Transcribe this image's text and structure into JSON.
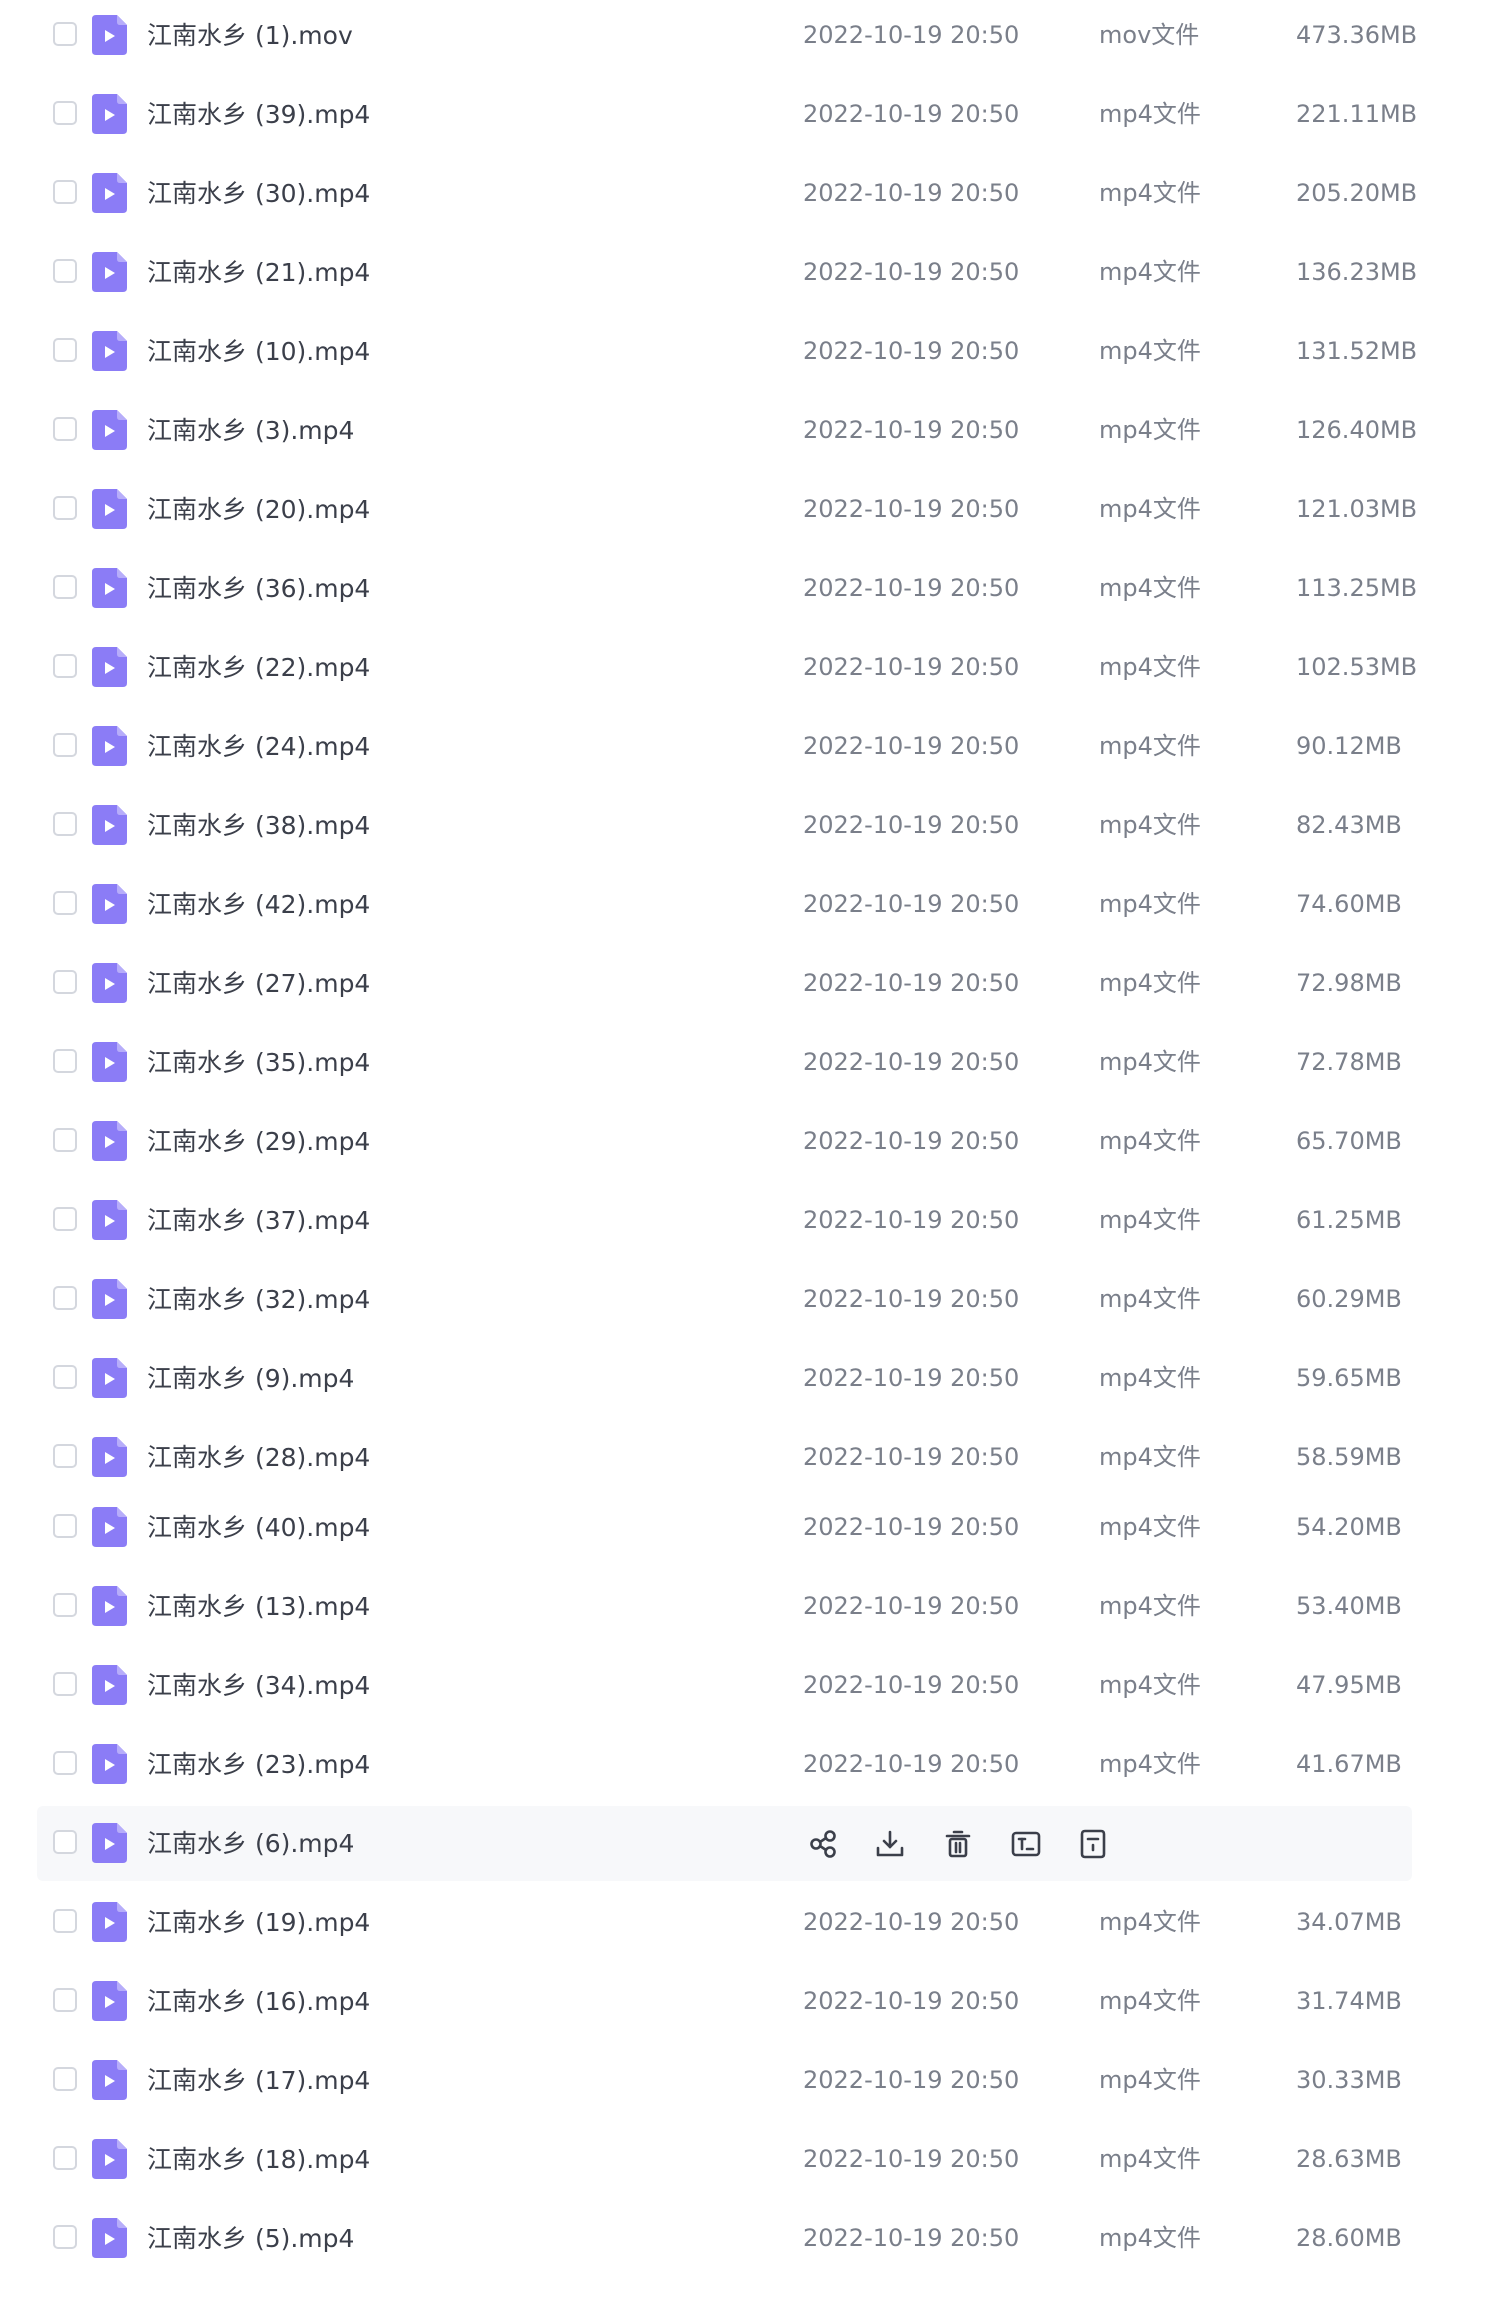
{
  "colors": {
    "icon_purple": "#8b7cf6",
    "text_primary": "#3b3f4a",
    "text_secondary": "#7a7f8a",
    "hover_row": "#f7f8fa"
  },
  "files": [
    {
      "name": "江南水乡 (1).mov",
      "date": "2022-10-19 20:50",
      "type": "mov文件",
      "size": "473.36MB"
    },
    {
      "name": "江南水乡 (39).mp4",
      "date": "2022-10-19 20:50",
      "type": "mp4文件",
      "size": "221.11MB"
    },
    {
      "name": "江南水乡 (30).mp4",
      "date": "2022-10-19 20:50",
      "type": "mp4文件",
      "size": "205.20MB"
    },
    {
      "name": "江南水乡 (21).mp4",
      "date": "2022-10-19 20:50",
      "type": "mp4文件",
      "size": "136.23MB"
    },
    {
      "name": "江南水乡 (10).mp4",
      "date": "2022-10-19 20:50",
      "type": "mp4文件",
      "size": "131.52MB"
    },
    {
      "name": "江南水乡 (3).mp4",
      "date": "2022-10-19 20:50",
      "type": "mp4文件",
      "size": "126.40MB"
    },
    {
      "name": "江南水乡 (20).mp4",
      "date": "2022-10-19 20:50",
      "type": "mp4文件",
      "size": "121.03MB"
    },
    {
      "name": "江南水乡 (36).mp4",
      "date": "2022-10-19 20:50",
      "type": "mp4文件",
      "size": "113.25MB"
    },
    {
      "name": "江南水乡 (22).mp4",
      "date": "2022-10-19 20:50",
      "type": "mp4文件",
      "size": "102.53MB"
    },
    {
      "name": "江南水乡 (24).mp4",
      "date": "2022-10-19 20:50",
      "type": "mp4文件",
      "size": "90.12MB"
    },
    {
      "name": "江南水乡 (38).mp4",
      "date": "2022-10-19 20:50",
      "type": "mp4文件",
      "size": "82.43MB"
    },
    {
      "name": "江南水乡 (42).mp4",
      "date": "2022-10-19 20:50",
      "type": "mp4文件",
      "size": "74.60MB"
    },
    {
      "name": "江南水乡 (27).mp4",
      "date": "2022-10-19 20:50",
      "type": "mp4文件",
      "size": "72.98MB"
    },
    {
      "name": "江南水乡 (35).mp4",
      "date": "2022-10-19 20:50",
      "type": "mp4文件",
      "size": "72.78MB"
    },
    {
      "name": "江南水乡 (29).mp4",
      "date": "2022-10-19 20:50",
      "type": "mp4文件",
      "size": "65.70MB"
    },
    {
      "name": "江南水乡 (37).mp4",
      "date": "2022-10-19 20:50",
      "type": "mp4文件",
      "size": "61.25MB"
    },
    {
      "name": "江南水乡 (32).mp4",
      "date": "2022-10-19 20:50",
      "type": "mp4文件",
      "size": "60.29MB"
    },
    {
      "name": "江南水乡 (9).mp4",
      "date": "2022-10-19 20:50",
      "type": "mp4文件",
      "size": "59.65MB"
    },
    {
      "name": "江南水乡 (28).mp4",
      "date": "2022-10-19 20:50",
      "type": "mp4文件",
      "size": "58.59MB"
    },
    {
      "name": "江南水乡 (40).mp4",
      "date": "2022-10-19 20:50",
      "type": "mp4文件",
      "size": "54.20MB"
    },
    {
      "name": "江南水乡 (13).mp4",
      "date": "2022-10-19 20:50",
      "type": "mp4文件",
      "size": "53.40MB"
    },
    {
      "name": "江南水乡 (34).mp4",
      "date": "2022-10-19 20:50",
      "type": "mp4文件",
      "size": "47.95MB"
    },
    {
      "name": "江南水乡 (23).mp4",
      "date": "2022-10-19 20:50",
      "type": "mp4文件",
      "size": "41.67MB"
    },
    {
      "name": "江南水乡 (6).mp4",
      "hovered": true
    },
    {
      "name": "江南水乡 (19).mp4",
      "date": "2022-10-19 20:50",
      "type": "mp4文件",
      "size": "34.07MB"
    },
    {
      "name": "江南水乡 (16).mp4",
      "date": "2022-10-19 20:50",
      "type": "mp4文件",
      "size": "31.74MB"
    },
    {
      "name": "江南水乡 (17).mp4",
      "date": "2022-10-19 20:50",
      "type": "mp4文件",
      "size": "30.33MB"
    },
    {
      "name": "江南水乡 (18).mp4",
      "date": "2022-10-19 20:50",
      "type": "mp4文件",
      "size": "28.63MB"
    },
    {
      "name": "江南水乡 (5).mp4",
      "date": "2022-10-19 20:50",
      "type": "mp4文件",
      "size": "28.60MB"
    }
  ],
  "hover_actions": [
    {
      "icon": "share-icon"
    },
    {
      "icon": "download-icon"
    },
    {
      "icon": "trash-icon"
    },
    {
      "icon": "rename-icon"
    },
    {
      "icon": "more-icon"
    }
  ]
}
